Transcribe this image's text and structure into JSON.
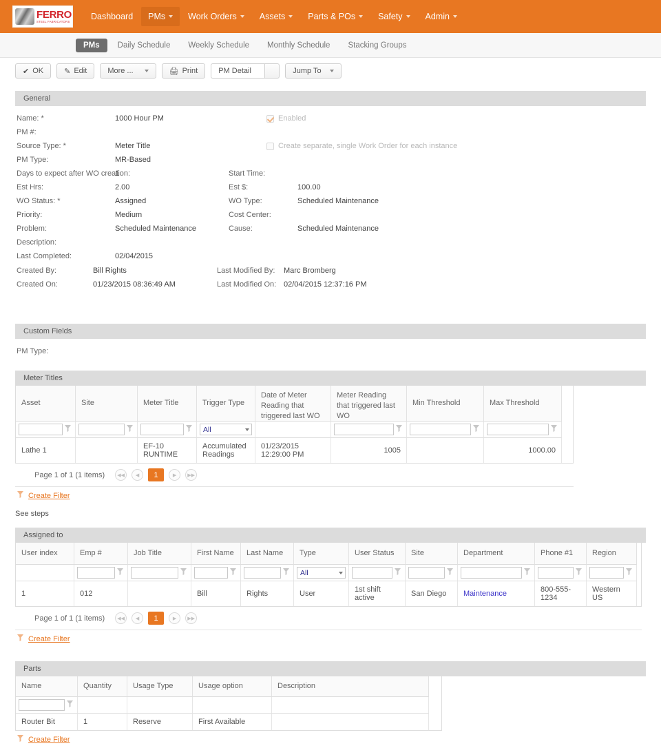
{
  "brand": {
    "name": "FERRO",
    "tagline": "STEEL FABRICATORS",
    "accent": "#E87722",
    "logo_red": "#D2232A"
  },
  "nav": {
    "items": [
      {
        "label": "Dashboard",
        "has_caret": false,
        "active": false
      },
      {
        "label": "PMs",
        "has_caret": true,
        "active": true
      },
      {
        "label": "Work Orders",
        "has_caret": true,
        "active": false
      },
      {
        "label": "Assets",
        "has_caret": true,
        "active": false
      },
      {
        "label": "Parts & POs",
        "has_caret": true,
        "active": false
      },
      {
        "label": "Safety",
        "has_caret": true,
        "active": false
      },
      {
        "label": "Admin",
        "has_caret": true,
        "active": false
      }
    ]
  },
  "subtabs": [
    {
      "label": "PMs",
      "active": true
    },
    {
      "label": "Daily Schedule",
      "active": false
    },
    {
      "label": "Weekly Schedule",
      "active": false
    },
    {
      "label": "Monthly Schedule",
      "active": false
    },
    {
      "label": "Stacking Groups",
      "active": false
    }
  ],
  "toolbar": {
    "ok_label": "OK",
    "edit_label": "Edit",
    "more_label": "More ...",
    "print_label": "Print",
    "view_label": "PM Detail",
    "jump_label": "Jump To"
  },
  "general": {
    "title": "General",
    "left_rows": [
      {
        "label": "Name: *",
        "value": "1000 Hour PM"
      },
      {
        "label": "PM #:",
        "value": ""
      },
      {
        "label": "Source Type: *",
        "value": "Meter Title"
      },
      {
        "label": "PM Type:",
        "value": "MR-Based"
      },
      {
        "label": "Days to expect after WO creation:",
        "value": "1"
      },
      {
        "label": "Est Hrs:",
        "value": "2.00"
      },
      {
        "label": "WO Status: *",
        "value": "Assigned"
      },
      {
        "label": "Priority:",
        "value": "Medium"
      },
      {
        "label": "Problem:",
        "value": "Scheduled Maintenance"
      },
      {
        "label": "Description:",
        "value": ""
      }
    ],
    "right_rows": [
      {
        "label": "Start Time:",
        "value": ""
      },
      {
        "label": "Est $:",
        "value": "100.00"
      },
      {
        "label": "WO Type:",
        "value": "Scheduled Maintenance"
      },
      {
        "label": "Cost Center:",
        "value": ""
      },
      {
        "label": "Cause:",
        "value": "Scheduled Maintenance"
      }
    ],
    "last_completed": {
      "label": "Last Completed:",
      "value": "02/04/2015"
    },
    "created_by": {
      "label": "Created By:",
      "value": "Bill Rights"
    },
    "created_on": {
      "label": "Created On:",
      "value": "01/23/2015 08:36:49 AM"
    },
    "modified_by": {
      "label": "Last Modified By:",
      "value": "Marc Bromberg"
    },
    "modified_on": {
      "label": "Last Modified On:",
      "value": "02/04/2015 12:37:16 PM"
    },
    "enabled_checkbox": {
      "label": "Enabled",
      "checked": true
    },
    "separate_wo_checkbox": {
      "label": "Create separate, single Work Order for each instance",
      "checked": false
    }
  },
  "custom_fields": {
    "title": "Custom Fields",
    "rows": [
      {
        "label": "PM Type:",
        "value": ""
      }
    ]
  },
  "meter_titles": {
    "title": "Meter Titles",
    "columns": [
      "Asset",
      "Site",
      "Meter Title",
      "Trigger Type",
      "Date of Meter Reading that triggered last WO",
      "Meter Reading that triggered last WO",
      "Min Threshold",
      "Max Threshold"
    ],
    "filters": [
      {
        "type": "text",
        "value": ""
      },
      {
        "type": "text",
        "value": ""
      },
      {
        "type": "text",
        "value": ""
      },
      {
        "type": "select",
        "value": "All"
      },
      {
        "type": "none",
        "value": ""
      },
      {
        "type": "text",
        "value": ""
      },
      {
        "type": "text",
        "value": ""
      },
      {
        "type": "text",
        "value": ""
      }
    ],
    "rows": [
      {
        "cells": [
          "Lathe 1",
          "",
          "EF-10 RUNTIME",
          "Accumulated Readings",
          "01/23/2015 12:29:00 PM",
          "1005",
          "",
          "1000.00"
        ]
      }
    ],
    "pager": {
      "text": "Page 1 of 1 (1 items)",
      "current": "1"
    },
    "create_filter": "Create Filter"
  },
  "see_steps": "See steps",
  "assigned_to": {
    "title": "Assigned to",
    "columns": [
      "User index",
      "Emp #",
      "Job Title",
      "First Name",
      "Last Name",
      "Type",
      "User Status",
      "Site",
      "Department",
      "Phone #1",
      "Region"
    ],
    "filters": [
      {
        "type": "none",
        "value": ""
      },
      {
        "type": "text",
        "value": ""
      },
      {
        "type": "text",
        "value": ""
      },
      {
        "type": "text",
        "value": ""
      },
      {
        "type": "text",
        "value": ""
      },
      {
        "type": "select",
        "value": "All"
      },
      {
        "type": "text",
        "value": ""
      },
      {
        "type": "text",
        "value": ""
      },
      {
        "type": "text",
        "value": ""
      },
      {
        "type": "text",
        "value": ""
      },
      {
        "type": "text",
        "value": ""
      }
    ],
    "rows": [
      {
        "cells": [
          "1",
          "012",
          "",
          "Bill",
          "Rights",
          "User",
          "1st shift active",
          "San Diego",
          "Maintenance",
          "800-555-1234",
          "Western US"
        ],
        "link_index": 8
      }
    ],
    "pager": {
      "text": "Page 1 of 1 (1 items)",
      "current": "1"
    },
    "create_filter": "Create Filter"
  },
  "parts": {
    "title": "Parts",
    "columns": [
      "Name",
      "Quantity",
      "Usage Type",
      "Usage option",
      "Description"
    ],
    "filters": [
      {
        "type": "text",
        "value": ""
      },
      {
        "type": "none",
        "value": ""
      },
      {
        "type": "none",
        "value": ""
      },
      {
        "type": "none",
        "value": ""
      },
      {
        "type": "none",
        "value": ""
      }
    ],
    "rows": [
      {
        "cells": [
          "Router Bit",
          "1",
          "Reserve",
          "First Available",
          ""
        ]
      }
    ],
    "create_filter": "Create Filter"
  }
}
